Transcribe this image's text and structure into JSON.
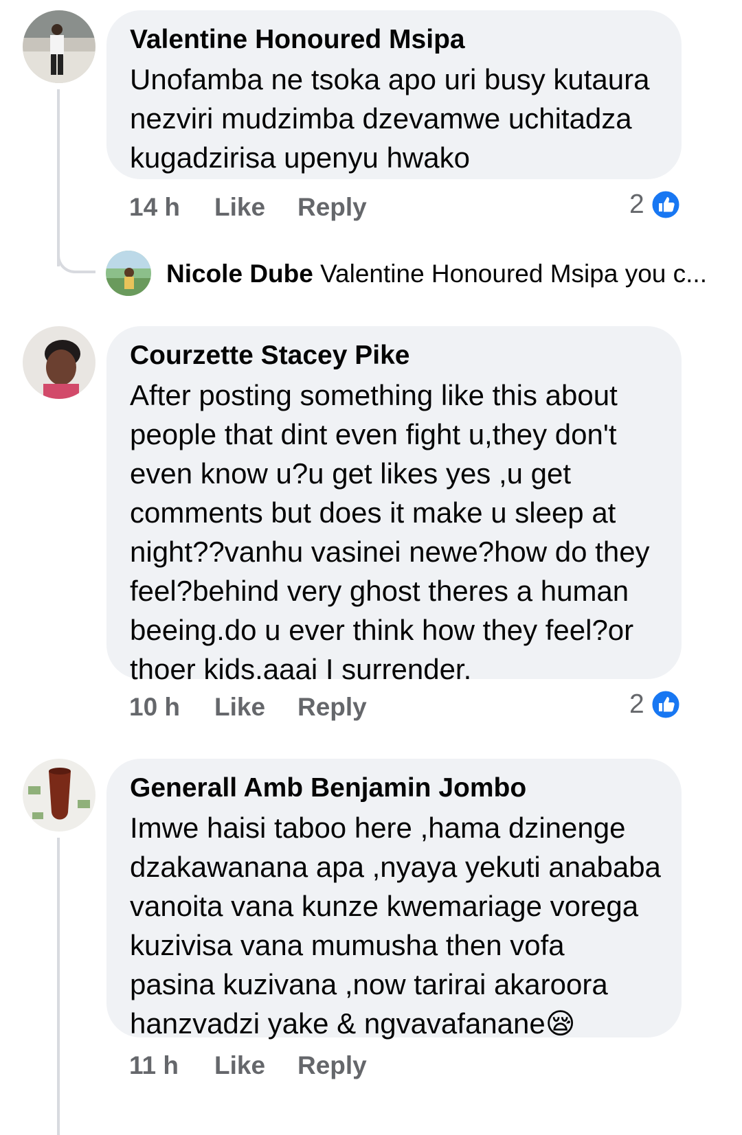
{
  "colors": {
    "bubble": "#f0f2f5",
    "meta_text": "#65676b",
    "like_blue": "#1877f2",
    "thread_line": "#d8dadf"
  },
  "comments": [
    {
      "author": "Valentine Honoured Msipa",
      "lines": [
        "Unofamba ne tsoka apo uri busy kutaura",
        "nezviri mudzimba dzevamwe uchitadza",
        "kugadzirisa upenyu hwako"
      ],
      "time": "14 h",
      "like_label": "Like",
      "reply_label": "Reply",
      "reaction_count": "2",
      "reaction_icon": "like-icon",
      "reply_preview": {
        "name": "Nicole Dube",
        "text": "Valentine Honoured Msipa you c..."
      }
    },
    {
      "author": "Courzette Stacey Pike",
      "lines": [
        "After posting something like this about",
        "people that dint even fight u,they don't",
        "even know u?u get likes yes ,u get",
        "comments but does it make u sleep at",
        "night??vanhu vasinei newe?how do they",
        "feel?behind very ghost theres a human",
        "beeing.do u ever think how they feel?or",
        "thoer kids.aaai I surrender."
      ],
      "time": "10 h",
      "like_label": "Like",
      "reply_label": "Reply",
      "reaction_count": "2",
      "reaction_icon": "like-icon"
    },
    {
      "author": "Generall Amb Benjamin Jombo",
      "lines": [
        "Imwe haisi taboo here ,hama dzinenge",
        "dzakawanana apa ,nyaya yekuti anababa",
        "vanoita vana kunze kwemariage vorega",
        "kuzivisa vana mumusha then vofa",
        "pasina kuzivana ,now tarirai akaroora",
        "hanzvadzi yake & ngvavafanane😪"
      ],
      "time": "11 h",
      "like_label": "Like",
      "reply_label": "Reply"
    }
  ]
}
